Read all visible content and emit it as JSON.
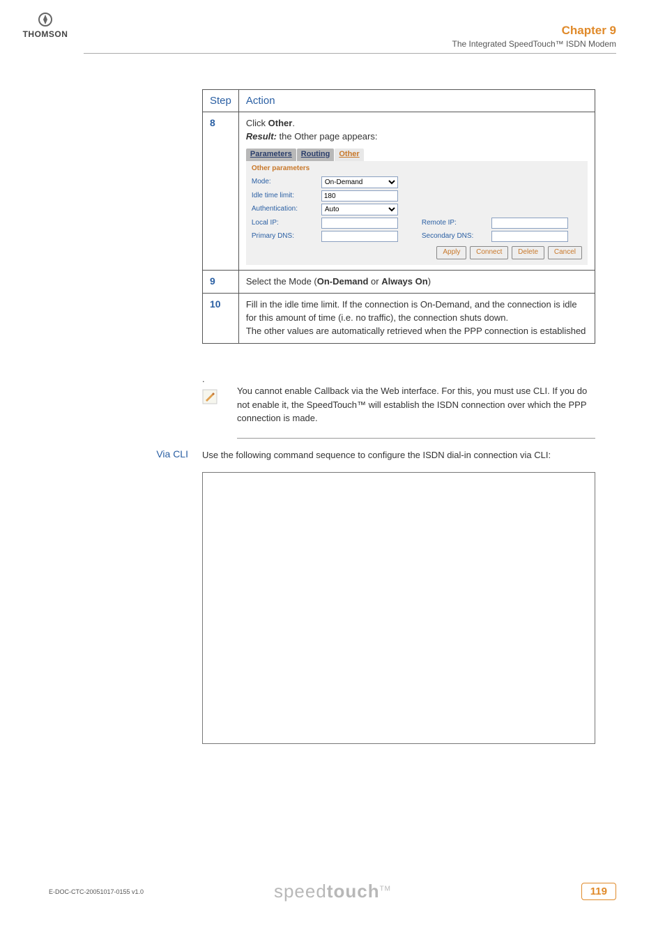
{
  "header": {
    "chapter": "Chapter 9",
    "subtitle": "The Integrated SpeedTouch™ ISDN Modem",
    "brand": "THOMSON"
  },
  "table": {
    "col_step": "Step",
    "col_action": "Action",
    "rows": [
      {
        "num": "8",
        "line1a": "Click ",
        "line1b": "Other",
        "line1c": ".",
        "line2a": "Result:",
        "line2b": " the Other page appears:",
        "ui": {
          "tabs": {
            "parameters": "Parameters",
            "routing": "Routing",
            "other": "Other"
          },
          "panel_title": "Other parameters",
          "mode_label": "Mode:",
          "idle_label": "Idle time limit:",
          "auth_label": "Authentication:",
          "localip_label": "Local IP:",
          "remoteip_label": "Remote IP:",
          "primdns_label": "Primary DNS:",
          "secdns_label": "Secondary DNS:",
          "mode_value": "On-Demand",
          "idle_value": "180",
          "auth_value": "Auto",
          "buttons": {
            "apply": "Apply",
            "connect": "Connect",
            "delete": "Delete",
            "cancel": "Cancel"
          }
        }
      },
      {
        "num": "9",
        "text_a": "Select the Mode (",
        "text_b1": "On-Demand",
        "text_mid": " or ",
        "text_b2": "Always On",
        "text_c": ")"
      },
      {
        "num": "10",
        "p1": "Fill in the idle time limit. If the connection is On-Demand, and the connection is idle for this amount of time (i.e. no traffic), the connection shuts down.",
        "p2": "The other values are automatically retrieved when the PPP connection is established"
      }
    ]
  },
  "note": {
    "dot": ".",
    "text": "You cannot enable Callback via the Web interface. For this, you must use CLI. If you do not enable it, the SpeedTouch™ will establish the ISDN connection over which the PPP connection is made."
  },
  "viacli": {
    "label": "Via CLI",
    "intro": "Use the following command sequence to configure the ISDN dial-in connection via CLI:"
  },
  "footer": {
    "doc": "E-DOC-CTC-20051017-0155 v1.0",
    "logo_a": "speed",
    "logo_b": "touch",
    "tm": "TM",
    "page": "119"
  }
}
